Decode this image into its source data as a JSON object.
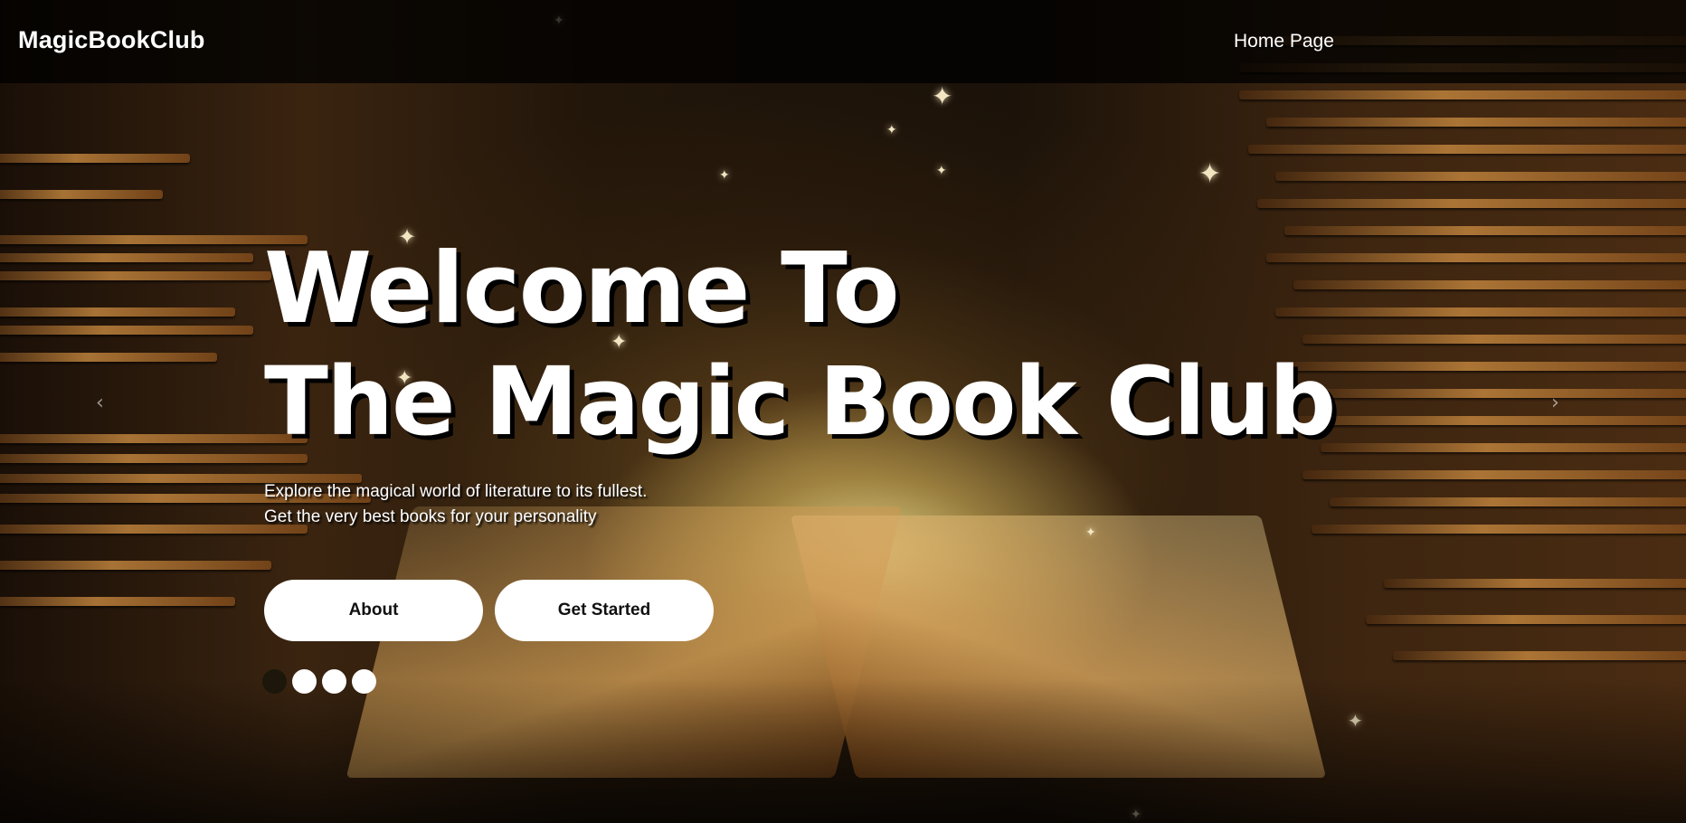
{
  "navbar": {
    "brand": "MagicBookClub",
    "links": [
      "Home Page"
    ]
  },
  "hero": {
    "headline_line1": "Welcome To",
    "headline_line2": "The Magic Book Club",
    "subtitle_line1": "Explore the magical world of literature to its fullest.",
    "subtitle_line2": "Get the very best books for your personality",
    "buttons": {
      "about": "About",
      "get_started": "Get Started"
    },
    "carousel": {
      "slide_count": 4,
      "active_index": 0,
      "prev_icon": "chevron-left-icon",
      "next_icon": "chevron-right-icon",
      "prev_glyph": "‹",
      "next_glyph": "›"
    }
  },
  "colors": {
    "navbar_bg": "#000000",
    "button_bg": "#ffffff",
    "button_text": "#111111",
    "text": "#ffffff"
  }
}
